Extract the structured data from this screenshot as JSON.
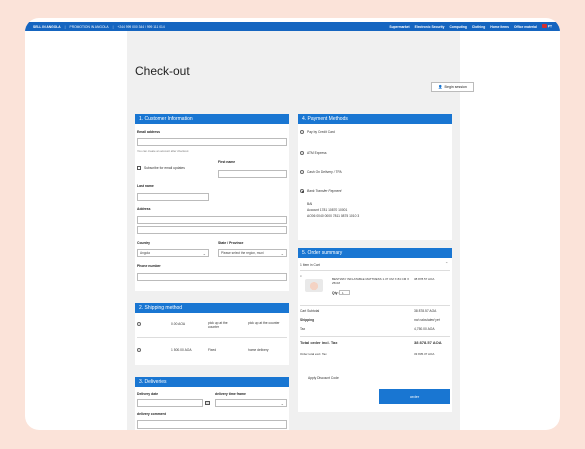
{
  "topbar": {
    "store_name": "SELL IN ANGOLA",
    "link": "PROMOTION IN ANGOLA",
    "phone": "+244 999 000 344 / 999 111 014",
    "nav": [
      "Supermarket",
      "Electronic Security",
      "Computing",
      "Clothing",
      "Home items",
      "Office material"
    ],
    "lang": "PT"
  },
  "page_title": "Check-out",
  "session_button": "Begin session",
  "customer": {
    "title": "1. Customer Information",
    "email_label": "Email address",
    "email_hint": "You can create an account after checkout",
    "subscribe_label": "Subscribe for email updates",
    "first_name_label": "First name",
    "last_name_label": "Last name",
    "address_label": "Address",
    "country_label": "Country",
    "country_value": "Angola",
    "state_label": "State / Province",
    "state_placeholder": "Please select the region, muni",
    "phone_label": "Phone number"
  },
  "shipping": {
    "title": "2. Shipping method",
    "rows": [
      {
        "price": "0.00 AOA",
        "method": "pick up at the counter",
        "carrier": "pick up at the counter"
      },
      {
        "price": "1 500.00 AOA",
        "method": "Fixed",
        "carrier": "home delivery"
      }
    ]
  },
  "deliveries": {
    "title": "3. Deliveries",
    "date_label": "Delivery date",
    "time_label": "delivery time frame",
    "comment_label": "delivery comment"
  },
  "payment": {
    "title": "4. Payment Methods",
    "options": [
      "Pay by Credit Card",
      "ATM Express",
      "Cash On Delivery / TPA",
      "Bank Transfer Payment"
    ],
    "selected": 3,
    "bank_info": [
      "BAI",
      "Account 1781 10870 10001",
      "AO06 0040 0000 7811 0875 1010 3"
    ]
  },
  "summary": {
    "title": "5. Order summary",
    "items_in_cart": "1 Item in Cart",
    "product_name": "BESTWAY INFLATABLE MATTRESS 1.37 CM X 84 CM X 25CM",
    "product_price": "38 878.57 AOA",
    "qty_label": "Qty:",
    "qty_value": "1",
    "subtotal_label": "Cart Subtotal",
    "subtotal_value": "38 878.57 AOA",
    "shipping_label": "Shipping",
    "shipping_value": "not calculated yet",
    "tax_label": "Tax",
    "tax_value": "4,750.00 AOA",
    "total_label": "Total order incl. Tax",
    "total_value": "38 878.57 AOA",
    "excl_label": "Order total excl. Tax",
    "excl_value": "33 835.37 AOA",
    "discount_label": "Apply Discount Code",
    "order_button": "order"
  }
}
